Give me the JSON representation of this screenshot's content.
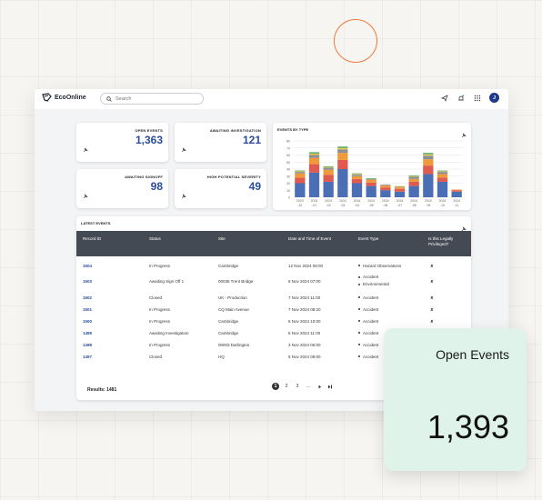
{
  "app": {
    "logo_text": "EcoOnline",
    "search_placeholder": "Search",
    "avatar_initial": "J"
  },
  "kpis": [
    {
      "label": "OPEN EVENTS",
      "value": "1,363"
    },
    {
      "label": "AWAITING INVESTIGATION",
      "value": "121"
    },
    {
      "label": "AWAITING SIGNOFF",
      "value": "98"
    },
    {
      "label": "HIGH POTENTIAL SEVERITY",
      "value": "49"
    }
  ],
  "chart_data": {
    "type": "bar",
    "title": "EVENTS BY TYPE",
    "categories": [
      "2023\n-12",
      "2024\n-01",
      "2024\n-02",
      "2024\n-03",
      "2024\n-04",
      "2024\n-05",
      "2024\n-06",
      "2024\n-07",
      "2024\n-08",
      "2024\n-09",
      "2024\n-10",
      "2024\n-11"
    ],
    "category_labels_top": [
      "2023",
      "2024",
      "2024",
      "2024",
      "2024",
      "2024",
      "2024",
      "2024",
      "2024",
      "2024",
      "2024",
      "2024"
    ],
    "category_labels_bottom": [
      "-12",
      "-01",
      "-02",
      "-03",
      "-04",
      "-05",
      "-06",
      "-07",
      "-08",
      "-09",
      "-10",
      "-11"
    ],
    "yticks": [
      0,
      10,
      20,
      30,
      40,
      50,
      60,
      70,
      80
    ],
    "ylim": [
      0,
      80
    ],
    "series": [
      {
        "values": [
          20,
          35,
          22,
          40,
          20,
          16,
          10,
          8,
          16,
          33,
          22,
          8
        ],
        "color": "#4a6fb5"
      },
      {
        "values": [
          8,
          12,
          10,
          13,
          6,
          5,
          4,
          4,
          6,
          12,
          6,
          2
        ],
        "color": "#e05a4f"
      },
      {
        "values": [
          6,
          9,
          7,
          10,
          4,
          4,
          3,
          2,
          4,
          9,
          5,
          1
        ],
        "color": "#ef9a3a"
      },
      {
        "values": [
          2,
          4,
          3,
          5,
          2,
          1,
          1,
          1,
          3,
          5,
          3,
          0
        ],
        "color": "#8a8f97"
      },
      {
        "values": [
          1,
          2,
          1,
          2,
          1,
          0,
          0,
          1,
          1,
          2,
          1,
          0
        ],
        "color": "#e6c84a"
      },
      {
        "values": [
          1,
          2,
          1,
          2,
          1,
          1,
          0,
          0,
          1,
          2,
          1,
          0
        ],
        "color": "#5aa86a"
      }
    ]
  },
  "table": {
    "title": "LATEST EVENTS",
    "headers": [
      "Record ID",
      "Status",
      "Site",
      "Date and Time of Event",
      "Event Type",
      "Is this Legally Privileged?"
    ],
    "rows": [
      {
        "id": "1504",
        "status": "In Progress",
        "site": "Cambridge",
        "date": "12 Nov 2024 09:00",
        "types": [
          "Hazard Observations"
        ],
        "priv": "✘"
      },
      {
        "id": "1503",
        "status": "Awaiting Sign Off 1",
        "site": "00035 Trent Bridge",
        "date": "6 Nov 2024 07:00",
        "types": [
          "Accident",
          "Environmental"
        ],
        "priv": "✘"
      },
      {
        "id": "1502",
        "status": "Closed",
        "site": "UK - Production",
        "date": "7 Nov 2024 11:00",
        "types": [
          "Accident"
        ],
        "priv": "✘"
      },
      {
        "id": "1501",
        "status": "In Progress",
        "site": "CQ Main Avenue",
        "date": "7 Nov 2024 08:20",
        "types": [
          "Accident"
        ],
        "priv": "✘"
      },
      {
        "id": "1500",
        "status": "In Progress",
        "site": "Cambridge",
        "date": "6 Nov 2024 10:00",
        "types": [
          "Accident"
        ],
        "priv": "✘"
      },
      {
        "id": "1499",
        "status": "Awaiting Investigation",
        "site": "Cambridge",
        "date": "6 Nov 2024 11:00",
        "types": [
          "Accident"
        ],
        "priv": ""
      },
      {
        "id": "1498",
        "status": "In Progress",
        "site": "00003 Darlington",
        "date": "3 Nov 2024 06:00",
        "types": [
          "Accident"
        ],
        "priv": ""
      },
      {
        "id": "1497",
        "status": "Closed",
        "site": "HQ",
        "date": "5 Nov 2024 08:00",
        "types": [
          "Accident"
        ],
        "priv": ""
      }
    ],
    "results": "Results: 1481",
    "pages": [
      "1",
      "2",
      "3",
      "..."
    ]
  },
  "float_card": {
    "title": "Open Events",
    "value": "1,393"
  }
}
